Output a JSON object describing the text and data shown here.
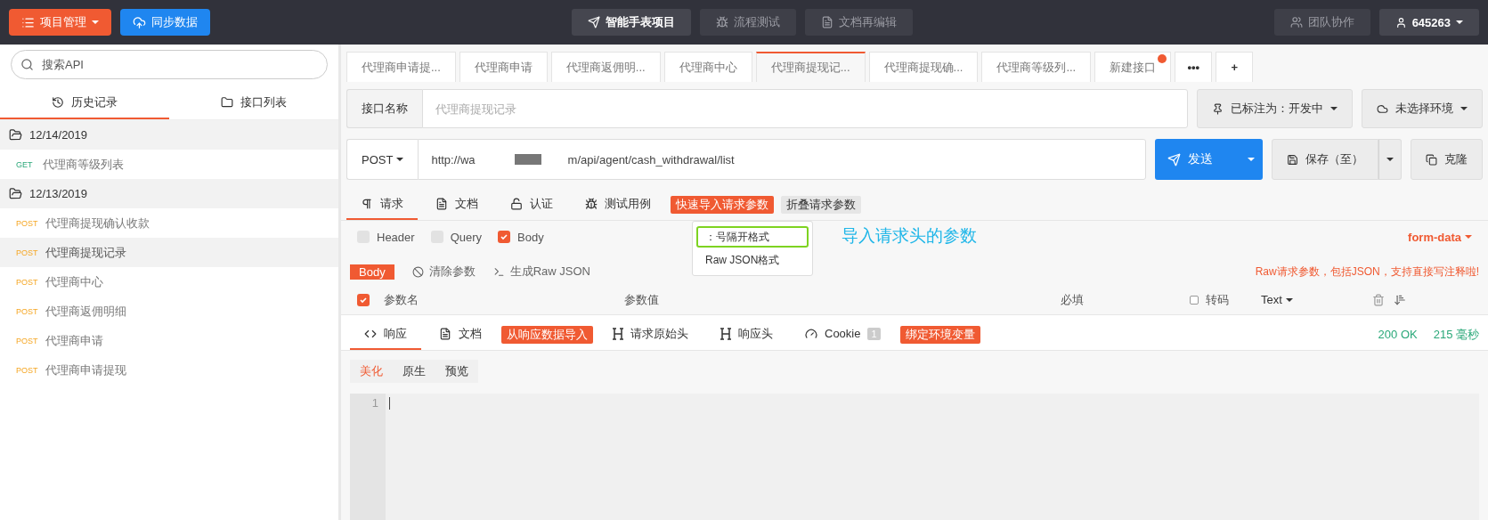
{
  "topbar": {
    "project_menu": "项目管理",
    "sync_button": "同步数据",
    "center_buttons": [
      {
        "label": "智能手表项目",
        "selected": true
      },
      {
        "label": "流程测试",
        "selected": false
      },
      {
        "label": "文档再编辑",
        "selected": false
      }
    ],
    "team_button": "团队协作",
    "user_button": "645263"
  },
  "sidebar": {
    "search": {
      "placeholder": "搜索API"
    },
    "tabs": [
      {
        "label": "历史记录",
        "selected": true
      },
      {
        "label": "接口列表",
        "selected": false
      }
    ],
    "groups": [
      {
        "date": "12/14/2019",
        "children": [
          {
            "method": "GET",
            "name": "代理商等级列表",
            "selected": false
          }
        ]
      },
      {
        "date": "12/13/2019",
        "children": [
          {
            "method": "POST",
            "name": "代理商提现确认收款",
            "selected": false
          },
          {
            "method": "POST",
            "name": "代理商提现记录",
            "selected": true
          },
          {
            "method": "POST",
            "name": "代理商中心",
            "selected": false
          },
          {
            "method": "POST",
            "name": "代理商返佣明细",
            "selected": false
          },
          {
            "method": "POST",
            "name": "代理商申请",
            "selected": false
          },
          {
            "method": "POST",
            "name": "代理商申请提现",
            "selected": false
          }
        ]
      }
    ]
  },
  "doc_tabs": [
    {
      "label": "代理商申请提...",
      "selected": false,
      "dot": false
    },
    {
      "label": "代理商申请",
      "selected": false,
      "dot": false
    },
    {
      "label": "代理商返佣明...",
      "selected": false,
      "dot": false
    },
    {
      "label": "代理商中心",
      "selected": false,
      "dot": false
    },
    {
      "label": "代理商提现记...",
      "selected": true,
      "dot": false
    },
    {
      "label": "代理商提现确...",
      "selected": false,
      "dot": false
    },
    {
      "label": "代理商等级列...",
      "selected": false,
      "dot": false
    },
    {
      "label": "新建接口",
      "selected": false,
      "dot": true
    }
  ],
  "doc_tab_actions": [
    "•••",
    "+"
  ],
  "name_row": {
    "label": "接口名称",
    "placeholder": "代理商提现记录",
    "status_button": "已标注为：开发中",
    "env_button": "未选择环境"
  },
  "url_row": {
    "method": "POST",
    "url_start": "http://wa",
    "url_end": "m/api/agent/cash_withdrawal/list",
    "send_button": "发送",
    "save_button": "保存（至）",
    "clone_button": "克隆"
  },
  "request_tabs": [
    {
      "kind": "tab",
      "label": "请求",
      "selected": true
    },
    {
      "kind": "tab",
      "label": "文档",
      "selected": false
    },
    {
      "kind": "tab",
      "label": "认证",
      "selected": false
    },
    {
      "kind": "tab",
      "label": "测试用例",
      "selected": false
    },
    {
      "kind": "tag",
      "label": "快速导入请求参数",
      "selected": true
    },
    {
      "kind": "tag",
      "label": "折叠请求参数",
      "selected": false
    }
  ],
  "import_menu": [
    {
      "label": "：号隔开格式",
      "selected": true
    },
    {
      "label": "Raw JSON格式",
      "selected": false
    }
  ],
  "annotation": "导入请求头的参数",
  "param_checks": [
    {
      "label": "Header",
      "checked": false
    },
    {
      "label": "Query",
      "checked": false
    },
    {
      "label": "Body",
      "checked": true
    }
  ],
  "body_type": "form-data",
  "body_bar": {
    "tag": "Body",
    "clear": "清除参数",
    "generate": "生成Raw JSON",
    "hint": "Raw请求参数，包括JSON，支持直接写注释啦!"
  },
  "params_header": {
    "all_checked": true,
    "name": "参数名",
    "value": "参数值",
    "required": "必填",
    "encode": {
      "label": "转码",
      "checked": false
    },
    "type": "Text"
  },
  "response_tabs": [
    {
      "kind": "tab",
      "label": "响应",
      "selected": true
    },
    {
      "kind": "tab",
      "label": "文档",
      "selected": false
    },
    {
      "kind": "tag",
      "label": "从响应数据导入",
      "selected": true
    },
    {
      "kind": "tab",
      "label": "请求原始头",
      "selected": false
    },
    {
      "kind": "tab",
      "label": "响应头",
      "selected": false
    },
    {
      "kind": "tab",
      "label": "Cookie",
      "count": "1",
      "selected": false
    },
    {
      "kind": "tag",
      "label": "绑定环境变量",
      "selected": true
    }
  ],
  "response_status": "200 OK",
  "response_time": "215 毫秒",
  "view_tabs": [
    {
      "label": "美化",
      "selected": true
    },
    {
      "label": "原生",
      "selected": false
    },
    {
      "label": "预览",
      "selected": false
    }
  ],
  "editor": {
    "line_numbers": [
      "1"
    ]
  }
}
